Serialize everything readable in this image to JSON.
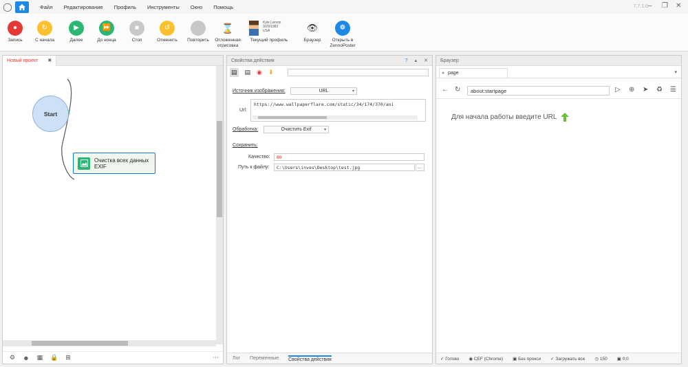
{
  "menu": {
    "items": [
      "Файл",
      "Редактирование",
      "Профиль",
      "Инструменты",
      "Окно",
      "Помощь"
    ],
    "version": "7.7.1.0"
  },
  "toolbar": {
    "record": "Запись",
    "from_start": "С начала",
    "next": "Далее",
    "to_end": "До конца",
    "stop": "Стоп",
    "undo": "Отменить",
    "redo": "Повторить",
    "deferred_line1": "Отложенная",
    "deferred_line2": "отрисовка",
    "profile_label": "Текущий профиль",
    "profile_name": "Kyle Larson",
    "profile_date": "3/20/1982",
    "profile_country": "USA",
    "browser": "Браузер",
    "open_zp_line1": "Открыть в",
    "open_zp_line2": "ZennoPoster"
  },
  "project": {
    "tab": "Новый проект",
    "start_node": "Start",
    "action_line1": "Очистка всех данных",
    "action_line2": "EXIF"
  },
  "props": {
    "title": "Свойства действия",
    "source_label": "Источник изображения:",
    "source_value": "URL",
    "url_label": "Url:",
    "url_value": "https://www.wallpaperflare.com/static/34/174/370/ani",
    "processing_label": "Обработка:",
    "processing_value": "Очистить Exif",
    "save_label": "Сохранить:",
    "quality_label": "Качество:",
    "quality_value": "80",
    "path_label": "Путь к файлу:",
    "path_value": "C:\\Users\\inves\\Desktop\\test.jpg",
    "browse": "...",
    "tabs": [
      "Лог",
      "Переменные",
      "Свойства действия"
    ]
  },
  "browser": {
    "title": "Браузер",
    "tab": "page",
    "url": "about:startpage",
    "hint": "Для начала работы введите URL",
    "status": {
      "ready": "Готово",
      "engine": "CEF (Chrome)",
      "proxy": "Без прокси",
      "load": "Загружать все",
      "count": "150",
      "coords": "0;0"
    }
  },
  "colors": {
    "accent": "#1e88e5",
    "record": "#e53935",
    "from_start": "#fbc02d",
    "next": "#2bb673",
    "node_border": "#1976d2"
  }
}
